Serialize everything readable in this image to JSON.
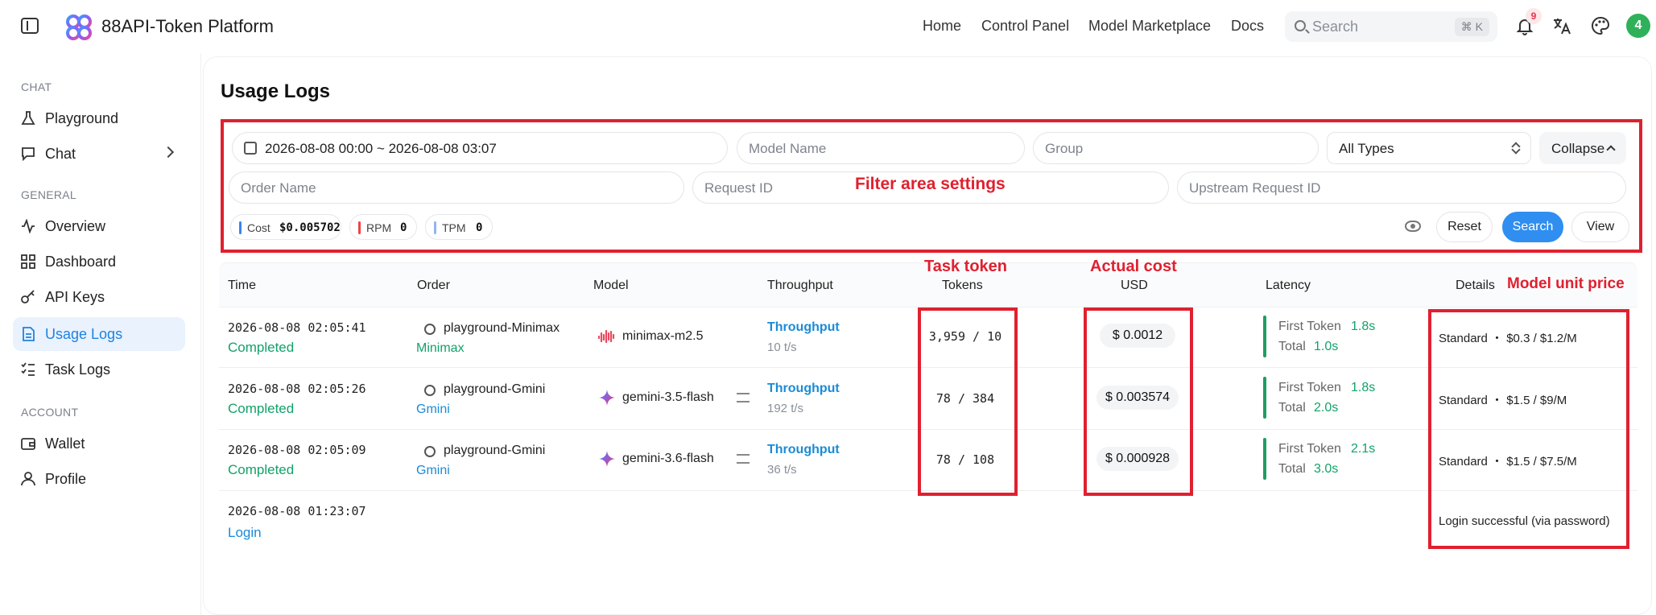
{
  "header": {
    "brand": "88API-Token Platform",
    "nav": [
      "Home",
      "Control Panel",
      "Model Marketplace",
      "Docs"
    ],
    "search_placeholder": "Search",
    "search_shortcut": "⌘ K",
    "notification_count": "9",
    "avatar_initial": "4"
  },
  "sidebar": {
    "sections": [
      {
        "title": "CHAT",
        "items": [
          {
            "label": "Playground",
            "icon": "flask-icon"
          },
          {
            "label": "Chat",
            "icon": "chat-icon"
          }
        ]
      },
      {
        "title": "GENERAL",
        "items": [
          {
            "label": "Overview",
            "icon": "activity-icon"
          },
          {
            "label": "Dashboard",
            "icon": "grid-icon"
          },
          {
            "label": "API Keys",
            "icon": "key-icon"
          },
          {
            "label": "Usage Logs",
            "icon": "document-icon",
            "active": true
          },
          {
            "label": "Task Logs",
            "icon": "checklist-icon"
          }
        ]
      },
      {
        "title": "ACCOUNT",
        "items": [
          {
            "label": "Wallet",
            "icon": "wallet-icon"
          },
          {
            "label": "Profile",
            "icon": "user-icon"
          }
        ]
      }
    ]
  },
  "page": {
    "title": "Usage Logs"
  },
  "filters": {
    "date_range": "2026-08-08 00:00 ~ 2026-08-08 03:07",
    "model_placeholder": "Model Name",
    "group_placeholder": "Group",
    "type_value": "All Types",
    "collapse_label": "Collapse",
    "order_placeholder": "Order Name",
    "request_id_placeholder": "Request ID",
    "upstream_placeholder": "Upstream Request ID",
    "stats": [
      {
        "label": "Cost",
        "value": "$0.005702",
        "color": "#3b82f6"
      },
      {
        "label": "RPM",
        "value": "0",
        "color": "#ef4444"
      },
      {
        "label": "TPM",
        "value": "0",
        "color": "#93b4f5"
      }
    ],
    "buttons": {
      "reset": "Reset",
      "search": "Search",
      "view": "View"
    }
  },
  "annotations": {
    "filter_area": "Filter area settings",
    "task_token": "Task token",
    "actual_cost": "Actual cost",
    "model_unit_price": "Model unit price"
  },
  "table": {
    "headers": {
      "time": "Time",
      "order": "Order",
      "model": "Model",
      "throughput": "Throughput",
      "tokens": "Tokens",
      "usd": "USD",
      "latency": "Latency",
      "details": "Details"
    },
    "rows": [
      {
        "time": "2026-08-08 02:05:41",
        "status": "Completed",
        "order": "playground-Minimax",
        "group": "Minimax",
        "model": "minimax-m2.5",
        "throughput_label": "Throughput",
        "throughput": "10 t/s",
        "tokens": "3,959 / 10",
        "usd": "$ 0.0012",
        "first_token_label": "First Token",
        "first_token": "1.8s",
        "total_label": "Total",
        "total": "1.0s",
        "details": "Standard ・ $0.3 / $1.2/M"
      },
      {
        "time": "2026-08-08 02:05:26",
        "status": "Completed",
        "order": "playground-Gmini",
        "group": "Gmini",
        "model": "gemini-3.5-flash",
        "throughput_label": "Throughput",
        "throughput": "192 t/s",
        "tokens": "78 / 384",
        "usd": "$ 0.003574",
        "first_token_label": "First Token",
        "first_token": "1.8s",
        "total_label": "Total",
        "total": "2.0s",
        "details": "Standard ・ $1.5 / $9/M"
      },
      {
        "time": "2026-08-08 02:05:09",
        "status": "Completed",
        "order": "playground-Gmini",
        "group": "Gmini",
        "model": "gemini-3.6-flash",
        "throughput_label": "Throughput",
        "throughput": "36 t/s",
        "tokens": "78 / 108",
        "usd": "$ 0.000928",
        "first_token_label": "First Token",
        "first_token": "2.1s",
        "total_label": "Total",
        "total": "3.0s",
        "details": "Standard ・ $1.5 / $7.5/M"
      },
      {
        "time": "2026-08-08 01:23:07",
        "status": "Login",
        "details": "Login successful (via password)"
      }
    ]
  }
}
